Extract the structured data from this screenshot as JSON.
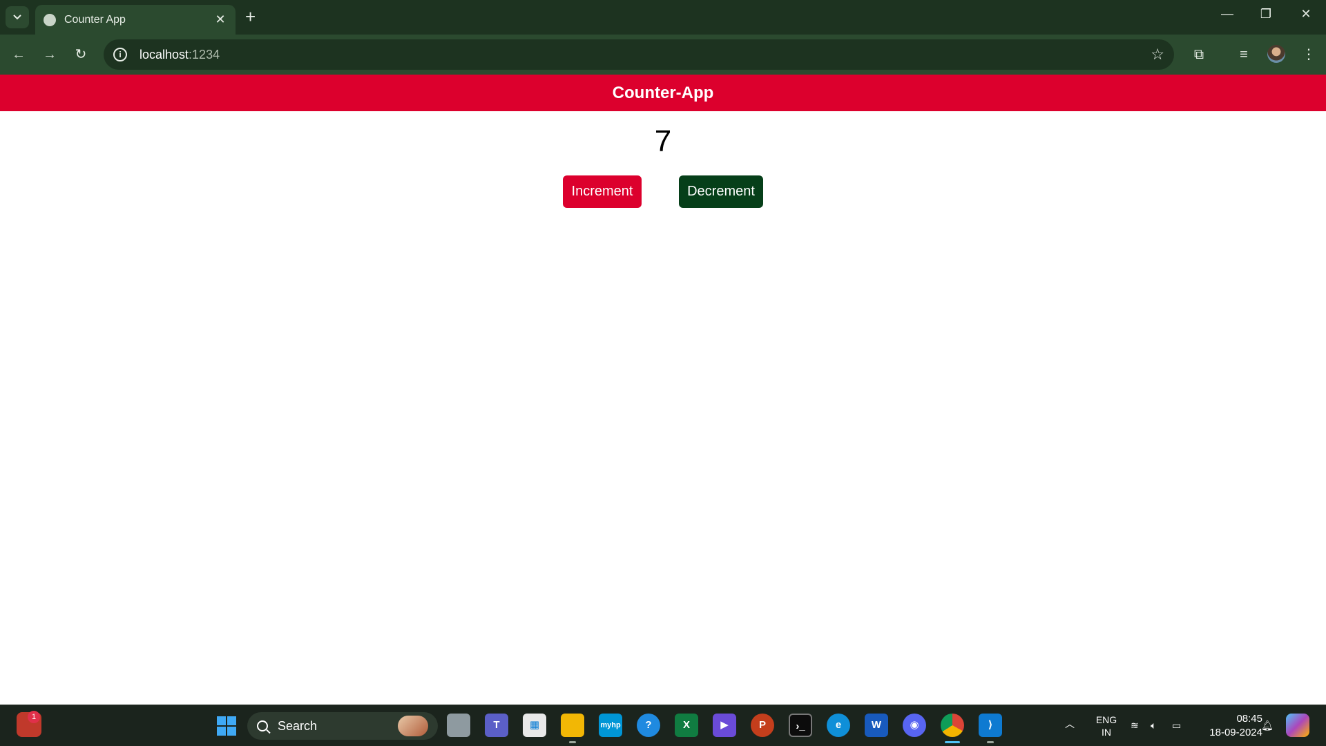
{
  "browser": {
    "tab_title": "Counter App",
    "new_tab": "+",
    "url_host": "localhost",
    "url_port": ":1234"
  },
  "app": {
    "title": "Counter-App",
    "count": "7",
    "increment_label": "Increment",
    "decrement_label": "Decrement"
  },
  "colors": {
    "header": "#dc002d",
    "increment": "#dc002d",
    "decrement": "#063f19",
    "browser_frame": "#1d3320"
  },
  "taskbar": {
    "search_label": "Search",
    "notification_count": "1",
    "lang_top": "ENG",
    "lang_bottom": "IN",
    "time": "08:45",
    "date": "18-09-2024"
  }
}
